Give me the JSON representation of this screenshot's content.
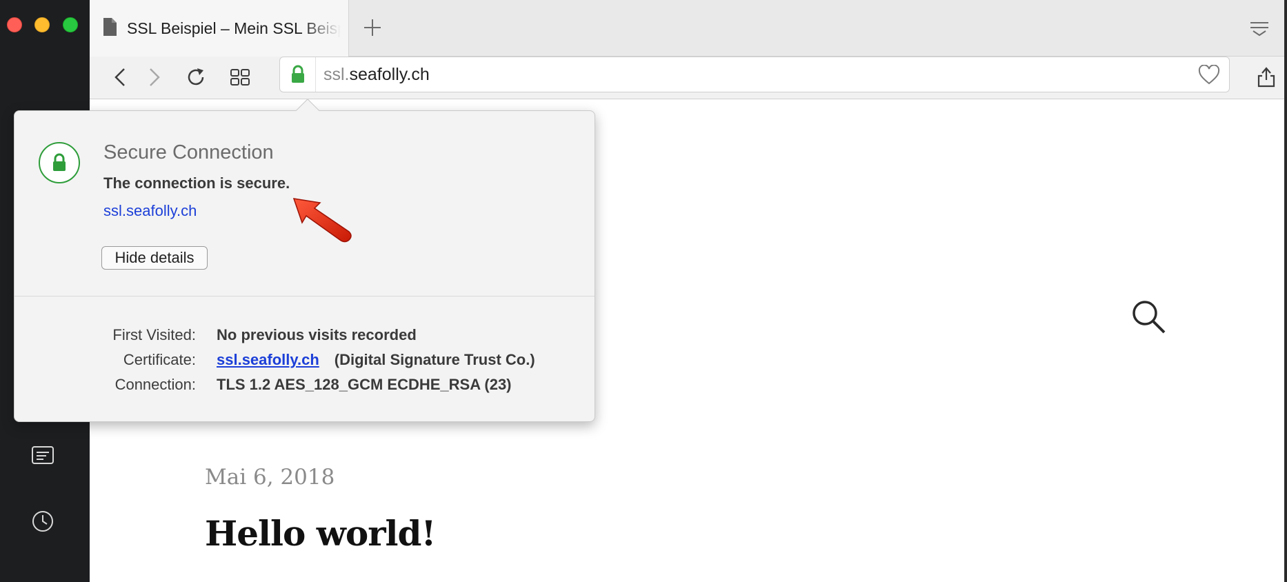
{
  "tab": {
    "title": "SSL Beispiel – Mein SSL Beispiel",
    "icon": "document-icon"
  },
  "toolbar": {
    "back": "chevron-left-icon",
    "forward": "chevron-right-icon",
    "reload": "reload-icon",
    "tabs_overview": "grid-icon",
    "share": "share-icon"
  },
  "address": {
    "subdomain": "ssl.",
    "domain": "seafolly.ch",
    "lock_color": "#3aa845"
  },
  "popup": {
    "heading": "Secure Connection",
    "status": "The connection is secure.",
    "host": "ssl.seafolly.ch",
    "hide_button": "Hide details",
    "rows": {
      "first_visited_label": "First Visited:",
      "first_visited_value": "No previous visits recorded",
      "certificate_label": "Certificate:",
      "certificate_link": "ssl.seafolly.ch",
      "certificate_issuer": "(Digital Signature Trust Co.)",
      "connection_label": "Connection:",
      "connection_value": "TLS 1.2 AES_128_GCM ECDHE_RSA (23)"
    }
  },
  "post": {
    "date": "Mai 6, 2018",
    "title": "Hello world!"
  },
  "colors": {
    "sidebar": "#1d1e20",
    "link": "#1c3fd8",
    "secure_green": "#2e9d3a",
    "annotation_arrow": "#e8210c"
  }
}
